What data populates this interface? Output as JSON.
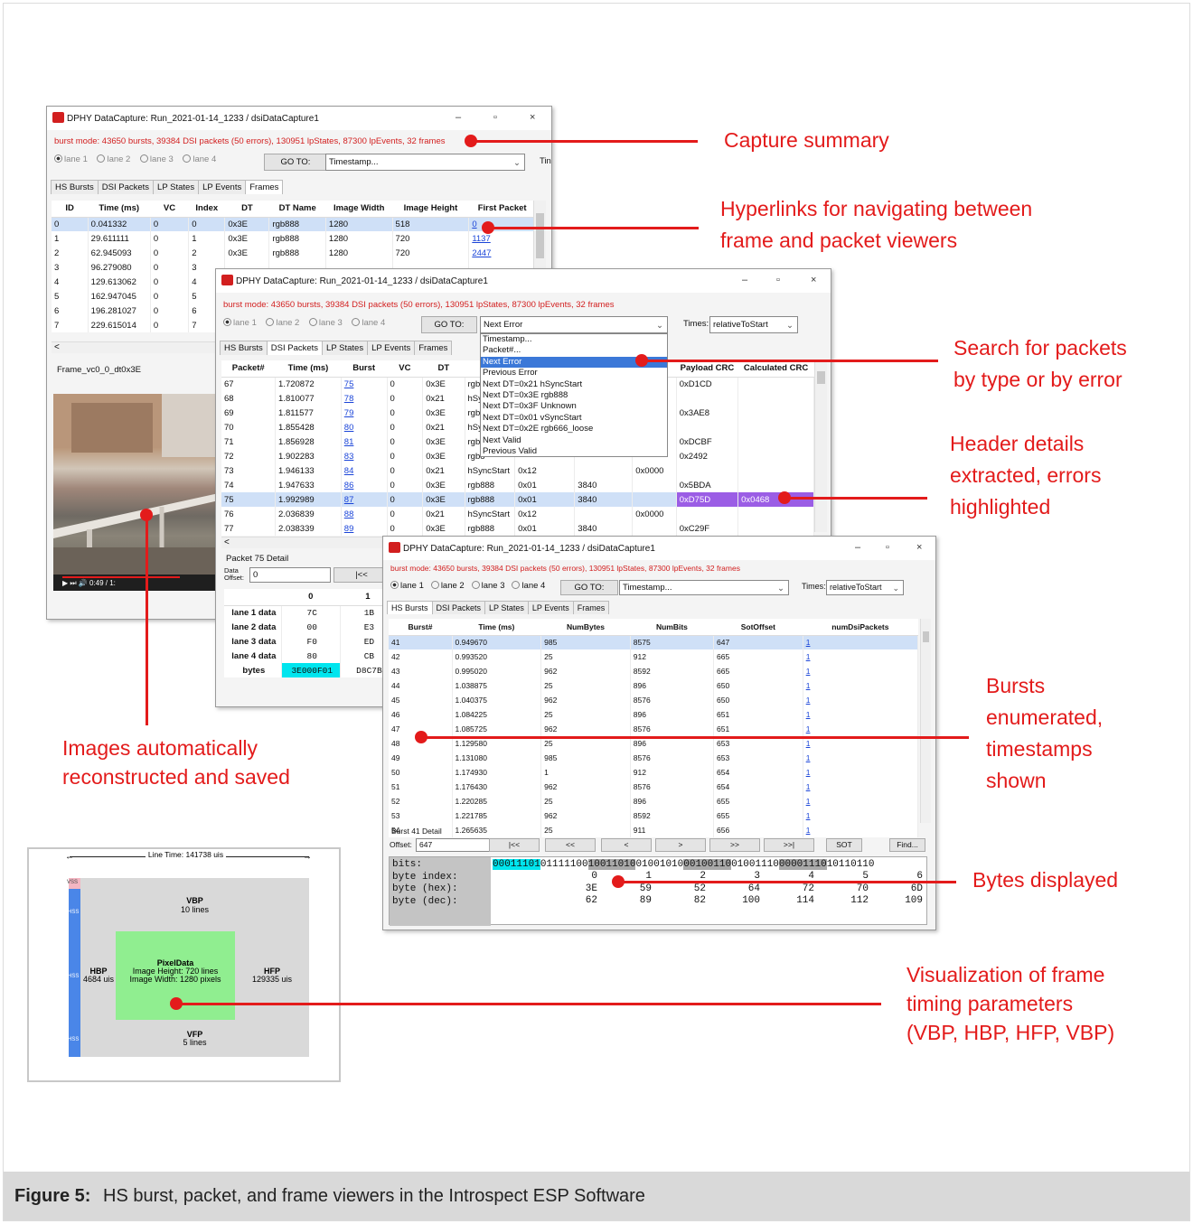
{
  "figure": {
    "label": "Figure 5:",
    "text": "HS burst, packet, and frame viewers in the Introspect ESP Software"
  },
  "annotations": {
    "capture_summary": "Capture summary",
    "hyperlinks_1": "Hyperlinks for navigating between",
    "hyperlinks_2": "frame and packet viewers",
    "search_1": "Search for packets",
    "search_2": "by type or by error",
    "header_1": "Header details",
    "header_2": "extracted, errors",
    "header_3": "highlighted",
    "bursts_1": "Bursts",
    "bursts_2": "enumerated,",
    "bursts_3": "timestamps",
    "bursts_4": "shown",
    "bytes": "Bytes displayed",
    "images_1": "Images automatically",
    "images_2": "reconstructed and saved",
    "vis_1": "Visualization of frame",
    "vis_2": "timing parameters",
    "vis_3": "(VBP, HBP, HFP, VBP)"
  },
  "window_common": {
    "title": "DPHY DataCapture: Run_2021-01-14_1233 / dsiDataCapture1",
    "summary": "burst mode: 43650 bursts, 39384 DSI packets (50 errors), 130951 lpStates, 87300 lpEvents, 32 frames",
    "lane1": "lane 1",
    "lane2": "lane 2",
    "lane3": "lane 3",
    "lane4": "lane 4",
    "goto": "GO TO:",
    "timestamp": "Timestamp...",
    "times_label": "Times:",
    "times_value": "relativeToStart",
    "tab_hs": "HS Bursts",
    "tab_dsi": "DSI Packets",
    "tab_lps": "LP States",
    "tab_lpe": "LP Events",
    "tab_frames": "Frames",
    "min": "–",
    "max": "▫",
    "close": "×"
  },
  "frames_window": {
    "times_cut": "Tin",
    "columns": [
      "ID",
      "Time (ms)",
      "VC",
      "Index",
      "DT",
      "DT Name",
      "Image Width",
      "Image Height",
      "First Packet"
    ],
    "rows": [
      [
        "0",
        "0.041332",
        "0",
        "0",
        "0x3E",
        "rgb888",
        "1280",
        "518",
        "0"
      ],
      [
        "1",
        "29.611111",
        "0",
        "1",
        "0x3E",
        "rgb888",
        "1280",
        "720",
        "1137"
      ],
      [
        "2",
        "62.945093",
        "0",
        "2",
        "0x3E",
        "rgb888",
        "1280",
        "720",
        "2447"
      ],
      [
        "3",
        "96.279080",
        "0",
        "3",
        "",
        "",
        "",
        "",
        ""
      ],
      [
        "4",
        "129.613062",
        "0",
        "4",
        "",
        "",
        "",
        "",
        ""
      ],
      [
        "5",
        "162.947045",
        "0",
        "5",
        "",
        "",
        "",
        "",
        ""
      ],
      [
        "6",
        "196.281027",
        "0",
        "6",
        "",
        "",
        "",
        "",
        ""
      ],
      [
        "7",
        "229.615014",
        "0",
        "7",
        "",
        "",
        "",
        "",
        ""
      ]
    ],
    "frame_name": "Frame_vc0_0_dt0x3E",
    "video_time": "0:49 / 1:"
  },
  "packets_window": {
    "dropdown_selected": "Next Error",
    "dropdown_options": [
      "Timestamp...",
      "Packet#...",
      "Next Error",
      "Previous Error",
      "Next DT=0x21 hSyncStart",
      "Next DT=0x3E rgb888",
      "Next DT=0x3F Unknown",
      "Next DT=0x01 vSyncStart",
      "Next DT=0x2E rgb666_loose",
      "Next Valid",
      "Previous Valid"
    ],
    "columns": [
      "Packet#",
      "Time (ms)",
      "Burst",
      "VC",
      "DT",
      "D",
      "",
      "",
      "",
      "Payload CRC",
      "Calculated CRC"
    ],
    "rows": [
      [
        "67",
        "1.720872",
        "75",
        "0",
        "0x3E",
        "rgb8",
        "",
        "",
        "",
        "0xD1CD",
        ""
      ],
      [
        "68",
        "1.810077",
        "78",
        "0",
        "0x21",
        "hSyn",
        "",
        "",
        "",
        "",
        ""
      ],
      [
        "69",
        "1.811577",
        "79",
        "0",
        "0x3E",
        "rgb8",
        "",
        "",
        "",
        "0x3AE8",
        ""
      ],
      [
        "70",
        "1.855428",
        "80",
        "0",
        "0x21",
        "hSyn",
        "",
        "",
        "",
        "",
        ""
      ],
      [
        "71",
        "1.856928",
        "81",
        "0",
        "0x3E",
        "rgb8",
        "",
        "",
        "",
        "0xDCBF",
        ""
      ],
      [
        "72",
        "1.902283",
        "83",
        "0",
        "0x3E",
        "rgb8",
        "",
        "",
        "",
        "0x2492",
        ""
      ],
      [
        "73",
        "1.946133",
        "84",
        "0",
        "0x21",
        "hSyncStart",
        "0x12",
        "",
        "0x0000",
        "",
        ""
      ],
      [
        "74",
        "1.947633",
        "86",
        "0",
        "0x3E",
        "rgb888",
        "0x01",
        "3840",
        "",
        "0x5BDA",
        ""
      ],
      [
        "75",
        "1.992989",
        "87",
        "0",
        "0x3E",
        "rgb888",
        "0x01",
        "3840",
        "",
        "0xD75D",
        "0x0468"
      ],
      [
        "76",
        "2.036839",
        "88",
        "0",
        "0x21",
        "hSyncStart",
        "0x12",
        "",
        "0x0000",
        "",
        ""
      ],
      [
        "77",
        "2.038339",
        "89",
        "0",
        "0x3E",
        "rgb888",
        "0x01",
        "3840",
        "",
        "0xC29F",
        ""
      ]
    ],
    "detail_title": "Packet 75 Detail",
    "data_offset_label": "Data Offset:",
    "data_offset_value": "0",
    "first_button": "|<<",
    "byte_cols": [
      "0",
      "1"
    ],
    "byte_rows": [
      [
        "lane 1 data",
        "7C",
        "1B"
      ],
      [
        "lane 2 data",
        "00",
        "E3"
      ],
      [
        "lane 3 data",
        "F0",
        "ED"
      ],
      [
        "lane 4 data",
        "80",
        "CB"
      ],
      [
        "bytes",
        "3E000F01",
        "D8C7B"
      ]
    ]
  },
  "bursts_window": {
    "columns": [
      "Burst#",
      "Time (ms)",
      "NumBytes",
      "NumBits",
      "SotOffset",
      "numDsiPackets"
    ],
    "rows": [
      [
        "41",
        "0.949670",
        "985",
        "8575",
        "647",
        "1"
      ],
      [
        "42",
        "0.993520",
        "25",
        "912",
        "665",
        "1"
      ],
      [
        "43",
        "0.995020",
        "962",
        "8592",
        "665",
        "1"
      ],
      [
        "44",
        "1.038875",
        "25",
        "896",
        "650",
        "1"
      ],
      [
        "45",
        "1.040375",
        "962",
        "8576",
        "650",
        "1"
      ],
      [
        "46",
        "1.084225",
        "25",
        "896",
        "651",
        "1"
      ],
      [
        "47",
        "1.085725",
        "962",
        "8576",
        "651",
        "1"
      ],
      [
        "48",
        "1.129580",
        "25",
        "896",
        "653",
        "1"
      ],
      [
        "49",
        "1.131080",
        "985",
        "8576",
        "653",
        "1"
      ],
      [
        "50",
        "1.174930",
        "1",
        "912",
        "654",
        "1"
      ],
      [
        "51",
        "1.176430",
        "962",
        "8576",
        "654",
        "1"
      ],
      [
        "52",
        "1.220285",
        "25",
        "896",
        "655",
        "1"
      ],
      [
        "53",
        "1.221785",
        "962",
        "8592",
        "655",
        "1"
      ],
      [
        "54",
        "1.265635",
        "25",
        "911",
        "656",
        "1"
      ]
    ],
    "detail_title": "Burst 41 Detail",
    "offset_label": "Offset:",
    "offset_value": "647",
    "nav_buttons": [
      "|<<",
      "<<",
      "<",
      ">",
      ">>",
      ">>|",
      "SOT",
      "Find..."
    ],
    "bits_label": "bits:",
    "bits_segments": [
      "00011101",
      "01111100",
      "10011010",
      "01001010",
      "00100110",
      "01001110",
      "00001110",
      "10110110"
    ],
    "byte_index_label": "byte index:",
    "byte_index": [
      "0",
      "1",
      "2",
      "3",
      "4",
      "5",
      "6"
    ],
    "byte_hex_label": "byte (hex):",
    "byte_hex": [
      "3E",
      "59",
      "52",
      "64",
      "72",
      "70",
      "6D"
    ],
    "byte_dec_label": "byte (dec):",
    "byte_dec": [
      "62",
      "89",
      "82",
      "100",
      "114",
      "112",
      "109"
    ]
  },
  "timing_diagram": {
    "line_time": "Line Time: 141738 uis",
    "vss": "VSS",
    "hss": "HSS",
    "vbp_title": "VBP",
    "vbp_sub": "10 lines",
    "hbp_title": "HBP",
    "hbp_sub": "4684 uis",
    "pixel_title": "PixelData",
    "pixel_h": "Image Height: 720 lines",
    "pixel_w": "Image Width: 1280 pixels",
    "hfp_title": "HFP",
    "hfp_sub": "129335 uis",
    "vfp_title": "VFP",
    "vfp_sub": "5 lines"
  },
  "colors": {
    "annotation": "#e31b1b",
    "selection": "#cfe0f7",
    "error_highlight": "#9b5de5",
    "bits_highlight": "#00e5ee",
    "pixel_green": "#90ee90",
    "hss_blue": "#4a86e8"
  }
}
